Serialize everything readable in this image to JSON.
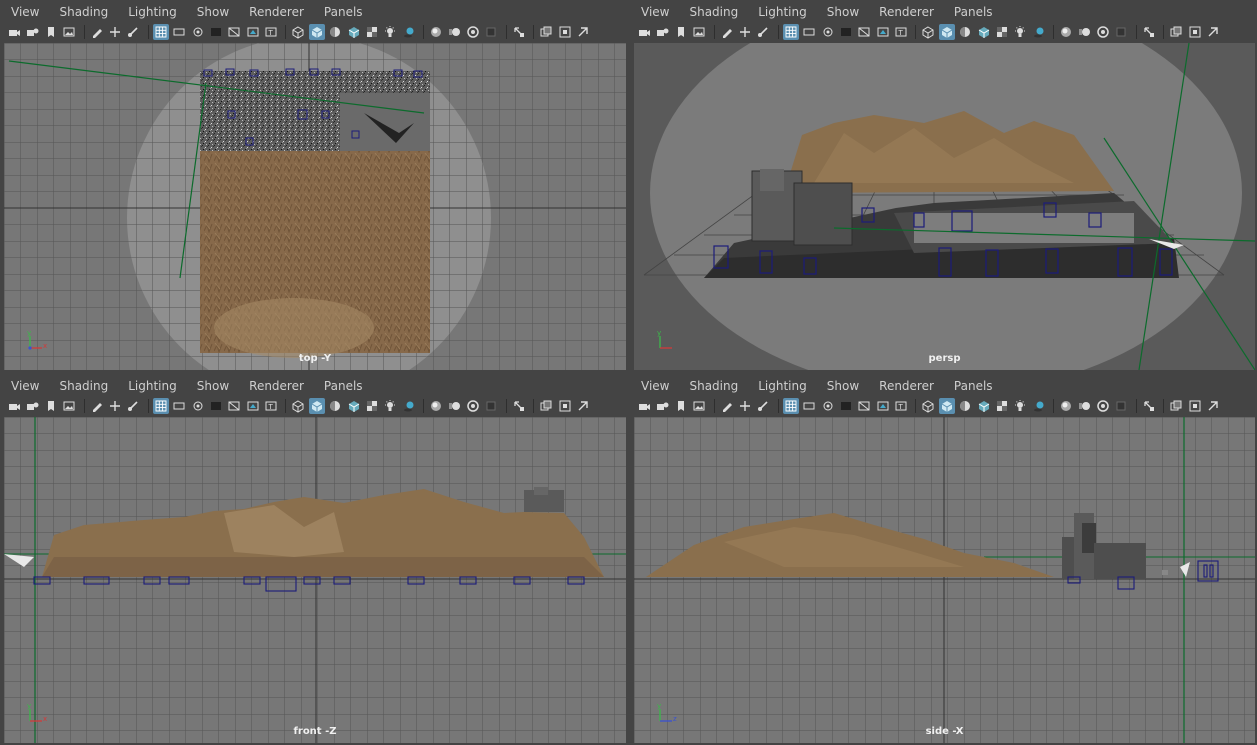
{
  "menu": [
    "View",
    "Shading",
    "Lighting",
    "Show",
    "Renderer",
    "Panels"
  ],
  "toolbar_icons": [
    {
      "name": "camera-select-icon",
      "on": false
    },
    {
      "name": "camera-attributes-icon",
      "on": false
    },
    {
      "name": "bookmark-icon",
      "on": false
    },
    {
      "name": "image-plane-icon",
      "on": false
    },
    {
      "name": "sep"
    },
    {
      "name": "grease-pencil-icon",
      "on": false
    },
    {
      "name": "2d-pan-zoom-icon",
      "on": false
    },
    {
      "name": "view-transform-icon",
      "on": false
    },
    {
      "name": "sep"
    },
    {
      "name": "grid-icon",
      "on": true
    },
    {
      "name": "film-gate-icon",
      "on": false
    },
    {
      "name": "resolution-gate-icon",
      "on": false
    },
    {
      "name": "gate-mask-icon",
      "on": false
    },
    {
      "name": "field-chart-icon",
      "on": false
    },
    {
      "name": "safe-action-icon",
      "on": false
    },
    {
      "name": "safe-title-icon",
      "on": false
    },
    {
      "name": "sep"
    },
    {
      "name": "wireframe-icon",
      "on": false
    },
    {
      "name": "smooth-shade-icon",
      "on": true
    },
    {
      "name": "default-material-icon",
      "on": false
    },
    {
      "name": "wireframe-on-shaded-icon",
      "on": false
    },
    {
      "name": "textured-icon",
      "on": false
    },
    {
      "name": "use-all-lights-icon",
      "on": false
    },
    {
      "name": "shadows-icon",
      "on": false
    },
    {
      "name": "sep"
    },
    {
      "name": "screen-space-ao-icon",
      "on": false
    },
    {
      "name": "motion-blur-icon",
      "on": false
    },
    {
      "name": "anti-aliasing-icon",
      "on": false
    },
    {
      "name": "depth-of-field-icon",
      "on": false
    },
    {
      "name": "sep"
    },
    {
      "name": "isolate-select-icon",
      "on": false
    },
    {
      "name": "sep"
    },
    {
      "name": "xray-icon",
      "on": false
    },
    {
      "name": "xray-joints-icon",
      "on": false
    },
    {
      "name": "backface-culling-icon",
      "on": false
    }
  ],
  "viewports": {
    "top": {
      "label": "top -Y"
    },
    "persp": {
      "label": "persp"
    },
    "front": {
      "label": "front -Z"
    },
    "side": {
      "label": "side -X"
    }
  },
  "axis_letters": {
    "x": "x",
    "y": "y",
    "z": "z"
  },
  "colors": {
    "panel_bg": "#444444",
    "viewport_bg": "#777777",
    "grid": "#555555",
    "grid_center": "#333333",
    "terrain": "#8a6f4d",
    "terrain_light": "#a58a66",
    "building": "#5a5a5a",
    "locator": "#1c1c7a",
    "axis_green": "#0c6b2c",
    "toggle_on": "#5a8fb0",
    "menu_text": "#cfcfcf",
    "label_text": "#f0f0f0"
  }
}
